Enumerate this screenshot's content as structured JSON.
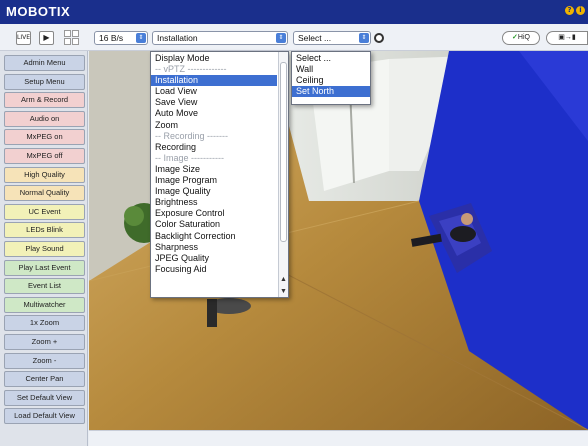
{
  "header": {
    "brand": "MOBOTIX",
    "icons": [
      "help-icon",
      "info-icon"
    ]
  },
  "toolbar": {
    "live_label": "LIVE",
    "play_label": "▶",
    "framerate": "16 B/s",
    "view_select": "Installation",
    "mount_select": "Select ...",
    "hiq_label": "HiQ",
    "colors": {
      "select_arrow": "#4a7fd8",
      "header": "#1a2f8c"
    }
  },
  "sidebar": {
    "buttons": [
      {
        "label": "Admin Menu",
        "color": "#c9d3e6"
      },
      {
        "label": "Setup Menu",
        "color": "#c9d3e6"
      },
      {
        "label": "Arm & Record",
        "color": "#f2d0d0"
      },
      {
        "label": "Audio on",
        "color": "#f2d0d0"
      },
      {
        "label": "MxPEG on",
        "color": "#f2d0d0"
      },
      {
        "label": "MxPEG off",
        "color": "#f2d0d0"
      },
      {
        "label": "High Quality",
        "color": "#f6e3b8"
      },
      {
        "label": "Normal Quality",
        "color": "#f6e3b8"
      },
      {
        "label": "UC Event",
        "color": "#f2f1b8"
      },
      {
        "label": "LEDs Blink",
        "color": "#f2f1b8"
      },
      {
        "label": "Play Sound",
        "color": "#f2f1b8"
      },
      {
        "label": "Play Last Event",
        "color": "#cfe8c6"
      },
      {
        "label": "Event List",
        "color": "#cfe8c6"
      },
      {
        "label": "Multiwatcher",
        "color": "#cfe8c6"
      },
      {
        "label": "1x Zoom",
        "color": "#c9d3e6"
      },
      {
        "label": "Zoom +",
        "color": "#c9d3e6"
      },
      {
        "label": "Zoom -",
        "color": "#c9d3e6"
      },
      {
        "label": "Center Pan",
        "color": "#c9d3e6"
      },
      {
        "label": "Set Default View",
        "color": "#c9d3e6"
      },
      {
        "label": "Load Default View",
        "color": "#c9d3e6"
      }
    ]
  },
  "view_menu": {
    "items": [
      {
        "label": "Display Mode",
        "type": "item"
      },
      {
        "label": "-- vPTZ -------------",
        "type": "sep"
      },
      {
        "label": "Installation",
        "type": "selected"
      },
      {
        "label": "Load View",
        "type": "item"
      },
      {
        "label": "Save View",
        "type": "item"
      },
      {
        "label": "Auto Move",
        "type": "item"
      },
      {
        "label": "Zoom",
        "type": "item"
      },
      {
        "label": "-- Recording -------",
        "type": "sep"
      },
      {
        "label": "Recording",
        "type": "item"
      },
      {
        "label": "-- Image -----------",
        "type": "sep"
      },
      {
        "label": "Image Size",
        "type": "item"
      },
      {
        "label": "Image Program",
        "type": "item"
      },
      {
        "label": "Image Quality",
        "type": "item"
      },
      {
        "label": "Brightness",
        "type": "item"
      },
      {
        "label": "Exposure Control",
        "type": "item"
      },
      {
        "label": "Color Saturation",
        "type": "item"
      },
      {
        "label": "Backlight Correction",
        "type": "item"
      },
      {
        "label": "Sharpness",
        "type": "item"
      },
      {
        "label": "JPEG Quality",
        "type": "item"
      },
      {
        "label": "Focusing Aid",
        "type": "item"
      }
    ]
  },
  "mount_menu": {
    "items": [
      {
        "label": "Select ...",
        "type": "item"
      },
      {
        "label": "Wall",
        "type": "item"
      },
      {
        "label": "Ceiling",
        "type": "item"
      },
      {
        "label": "Set North",
        "type": "selected"
      }
    ]
  }
}
